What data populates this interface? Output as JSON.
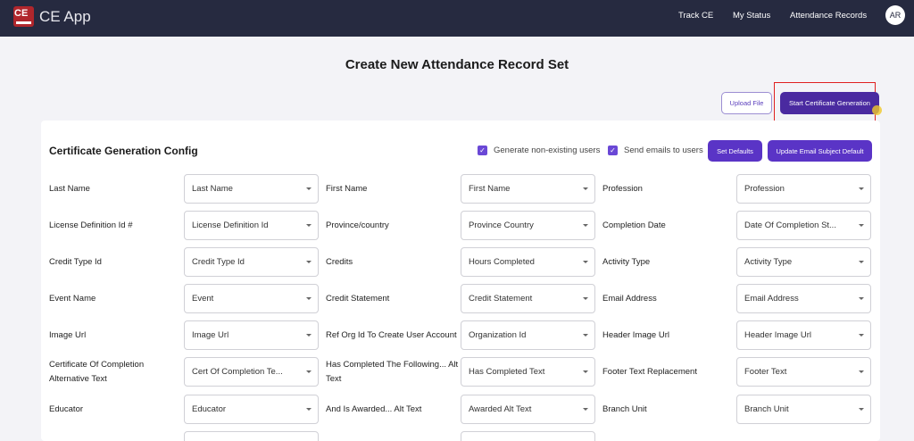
{
  "header": {
    "logo_text": "CE",
    "app_title": "CE App",
    "nav": [
      "Track CE",
      "My Status",
      "Attendance Records"
    ],
    "avatar": "AR"
  },
  "page": {
    "title": "Create New Attendance Record Set"
  },
  "actions": {
    "upload": "Upload File",
    "start": "Start Certificate Generation"
  },
  "config": {
    "title": "Certificate Generation Config",
    "generate_label": "Generate non-existing users",
    "generate_checked": true,
    "send_label": "Send emails to users",
    "send_checked": true,
    "set_defaults": "Set Defaults",
    "update_subject": "Update Email Subject Default"
  },
  "fields": [
    {
      "label": "Last Name",
      "value": "Last Name"
    },
    {
      "label": "First Name",
      "value": "First Name"
    },
    {
      "label": "Profession",
      "value": "Profession"
    },
    {
      "label": "License Definition Id #",
      "value": "License Definition Id"
    },
    {
      "label": "Province/country",
      "value": "Province Country"
    },
    {
      "label": "Completion Date",
      "value": "Date Of Completion St..."
    },
    {
      "label": "Credit Type Id",
      "value": "Credit Type Id"
    },
    {
      "label": "Credits",
      "value": "Hours Completed"
    },
    {
      "label": "Activity Type",
      "value": "Activity Type"
    },
    {
      "label": "Event Name",
      "value": "Event"
    },
    {
      "label": "Credit Statement",
      "value": "Credit Statement"
    },
    {
      "label": "Email Address",
      "value": "Email Address"
    },
    {
      "label": "Image Url",
      "value": "Image Url"
    },
    {
      "label": "Ref Org Id To Create User Account",
      "value": "Organization Id"
    },
    {
      "label": "Header Image Url",
      "value": "Header Image Url"
    },
    {
      "label": "Certificate Of Completion Alternative Text",
      "value": "Cert Of Completion Te..."
    },
    {
      "label": "Has Completed The Following... Alt Text",
      "value": "Has Completed Text"
    },
    {
      "label": "Footer Text Replacement",
      "value": "Footer Text"
    },
    {
      "label": "Educator",
      "value": "Educator"
    },
    {
      "label": "And Is Awarded... Alt Text",
      "value": "Awarded Alt Text"
    },
    {
      "label": "Branch Unit",
      "value": "Branch Unit"
    }
  ],
  "colors": {
    "header_bg": "#262a40",
    "primary": "#5a34c6",
    "highlight_outline": "#e02020"
  }
}
